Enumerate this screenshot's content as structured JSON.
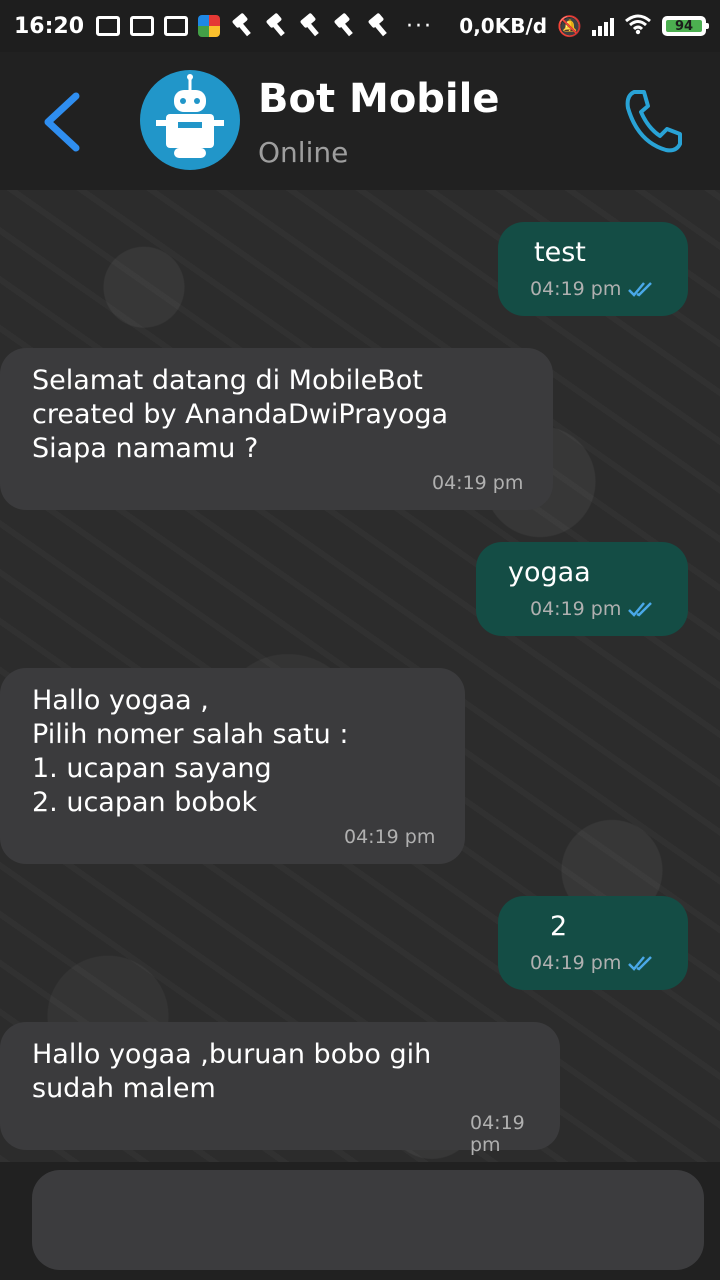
{
  "status_bar": {
    "time": "16:20",
    "network_speed": "0,0KB/d",
    "battery_level": "94",
    "icons": [
      "vpn-icon",
      "mail-icon",
      "gmail-icon",
      "app-icon",
      "hammer-icon",
      "hammer-icon",
      "hammer-icon",
      "hammer-icon",
      "hammer-icon"
    ],
    "more": "···"
  },
  "header": {
    "name": "Bot Mobile",
    "status": "Online",
    "accent_color": "#2f8ef0",
    "call_color": "#29a3d6"
  },
  "messages": [
    {
      "direction": "out",
      "text": "test",
      "time": "04:19 pm",
      "read": true
    },
    {
      "direction": "in",
      "text": "Selamat datang di MobileBot\ncreated by AnandaDwiPrayoga\nSiapa namamu ?",
      "time": "04:19 pm"
    },
    {
      "direction": "out",
      "text": "yogaa",
      "time": "04:19 pm",
      "read": true
    },
    {
      "direction": "in",
      "text": "Hallo yogaa ,\nPilih nomer salah satu :\n1. ucapan sayang\n2. ucapan bobok",
      "time": "04:19 pm"
    },
    {
      "direction": "out",
      "text": "2",
      "time": "04:19 pm",
      "read": true
    },
    {
      "direction": "in",
      "text": "Hallo yogaa ,buruan bobo gih\nsudah malem",
      "time": "04:19 pm"
    }
  ],
  "composer": {
    "placeholder": ""
  }
}
